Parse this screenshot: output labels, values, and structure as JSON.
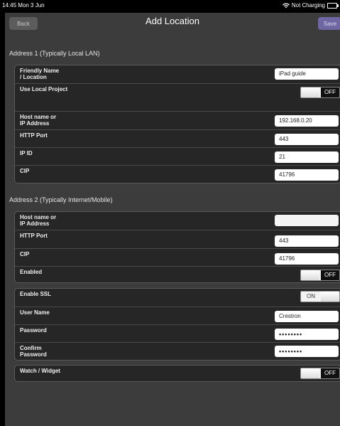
{
  "status_bar": {
    "time": "14:45  Mon 3 Jun",
    "battery_text": "Not Charging"
  },
  "nav": {
    "back_label": "Back",
    "title": "Add Location",
    "save_label": "Save"
  },
  "section1": {
    "header": "Address 1 (Typically Local LAN)",
    "friendly_name": {
      "label": "Friendly Name\n/ Location",
      "value": "iPad guide"
    },
    "use_local_project": {
      "label": "Use Local Project",
      "state": "OFF"
    },
    "host": {
      "label": "Host name or\nIP Address",
      "value": "192.168.0.20"
    },
    "http_port": {
      "label": "HTTP Port",
      "value": "443"
    },
    "ip_id": {
      "label": "IP ID",
      "value": "21"
    },
    "cip": {
      "label": "CIP",
      "value": "41796"
    }
  },
  "section2": {
    "header": "Address 2 (Typically Internet/Mobile)",
    "host": {
      "label": "Host name or\nIP Address",
      "value": ""
    },
    "http_port": {
      "label": "HTTP Port",
      "value": "443"
    },
    "cip": {
      "label": "CIP",
      "value": "41796"
    },
    "enabled": {
      "label": "Enabled",
      "state": "OFF"
    }
  },
  "security": {
    "enable_ssl": {
      "label": "Enable SSL",
      "state": "ON"
    },
    "user_name": {
      "label": "User Name",
      "value": "Crestron"
    },
    "password": {
      "label": "Password",
      "value": "••••••••"
    },
    "confirm_password": {
      "label": "Confirm\nPassword",
      "value": "••••••••"
    }
  },
  "widget": {
    "watch_widget": {
      "label": "Watch / Widget",
      "state": "OFF"
    }
  }
}
